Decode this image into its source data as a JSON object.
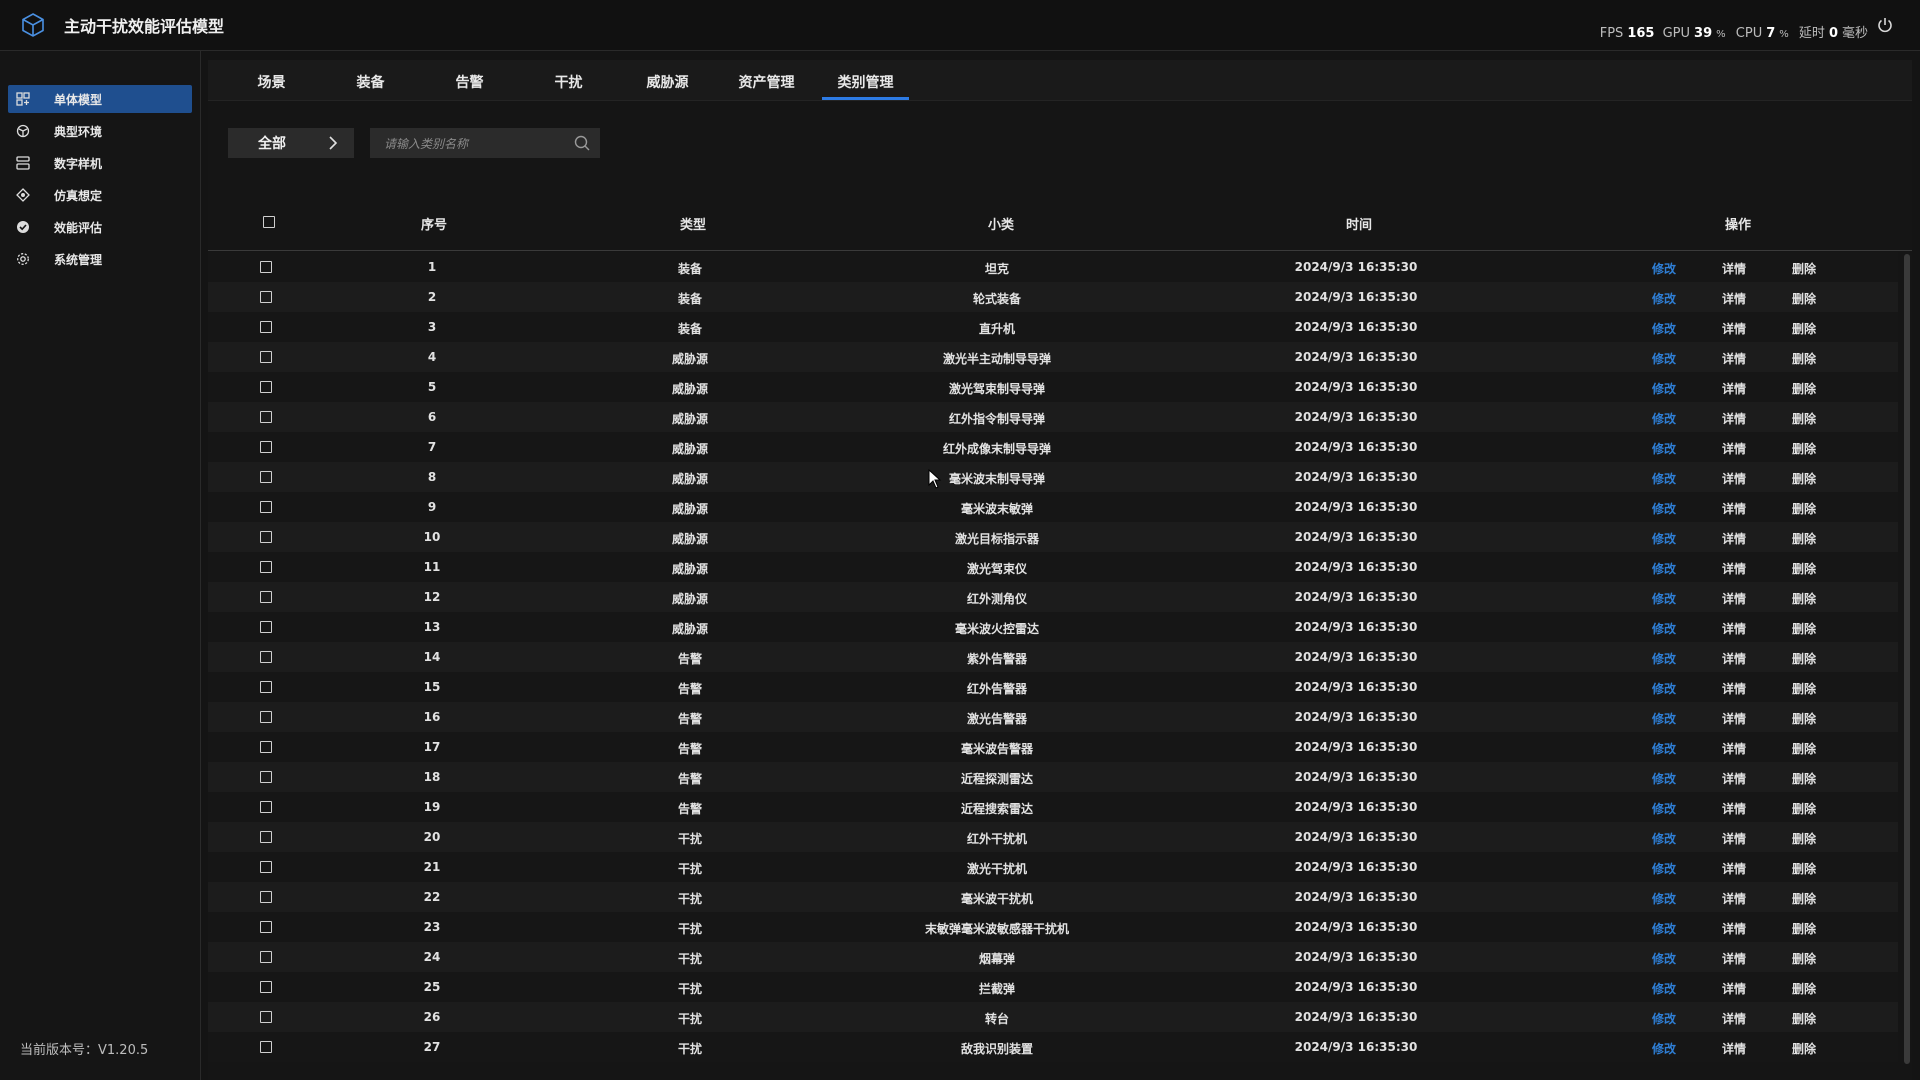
{
  "app": {
    "title": "主动干扰效能评估模型"
  },
  "perf": {
    "fps_label": "FPS",
    "fps": "165",
    "gpu_label": "GPU",
    "gpu": "39",
    "gpu_unit": "%",
    "cpu_label": "CPU",
    "cpu": "7",
    "cpu_unit": "%",
    "latency_label": "延时",
    "latency": "0",
    "latency_unit": "毫秒"
  },
  "sidebar": {
    "items": [
      {
        "label": "单体模型",
        "icon": "single-model-icon",
        "active": true
      },
      {
        "label": "典型环境",
        "icon": "environment-icon"
      },
      {
        "label": "数字样机",
        "icon": "prototype-icon"
      },
      {
        "label": "仿真想定",
        "icon": "simulation-icon"
      },
      {
        "label": "效能评估",
        "icon": "evaluation-icon"
      },
      {
        "label": "系统管理",
        "icon": "settings-icon"
      }
    ],
    "version": "当前版本号：V1.20.5"
  },
  "tabs": [
    {
      "label": "场景"
    },
    {
      "label": "装备"
    },
    {
      "label": "告警"
    },
    {
      "label": "干扰"
    },
    {
      "label": "威胁源"
    },
    {
      "label": "资产管理"
    },
    {
      "label": "类别管理",
      "active": true
    }
  ],
  "toolbar": {
    "filter_label": "全部",
    "search_placeholder": "请输入类别名称"
  },
  "table": {
    "columns": {
      "index": "序号",
      "type": "类型",
      "subtype": "小类",
      "time": "时间",
      "ops": "操作"
    },
    "ops": {
      "edit": "修改",
      "detail": "详情",
      "delete": "删除"
    },
    "rows": [
      {
        "index": "1",
        "type": "装备",
        "subtype": "坦克",
        "time": "2024/9/3 16:35:30"
      },
      {
        "index": "2",
        "type": "装备",
        "subtype": "轮式装备",
        "time": "2024/9/3 16:35:30"
      },
      {
        "index": "3",
        "type": "装备",
        "subtype": "直升机",
        "time": "2024/9/3 16:35:30"
      },
      {
        "index": "4",
        "type": "威胁源",
        "subtype": "激光半主动制导导弹",
        "time": "2024/9/3 16:35:30"
      },
      {
        "index": "5",
        "type": "威胁源",
        "subtype": "激光驾束制导导弹",
        "time": "2024/9/3 16:35:30"
      },
      {
        "index": "6",
        "type": "威胁源",
        "subtype": "红外指令制导导弹",
        "time": "2024/9/3 16:35:30"
      },
      {
        "index": "7",
        "type": "威胁源",
        "subtype": "红外成像末制导导弹",
        "time": "2024/9/3 16:35:30"
      },
      {
        "index": "8",
        "type": "威胁源",
        "subtype": "毫米波末制导导弹",
        "time": "2024/9/3 16:35:30"
      },
      {
        "index": "9",
        "type": "威胁源",
        "subtype": "毫米波末敏弹",
        "time": "2024/9/3 16:35:30"
      },
      {
        "index": "10",
        "type": "威胁源",
        "subtype": "激光目标指示器",
        "time": "2024/9/3 16:35:30"
      },
      {
        "index": "11",
        "type": "威胁源",
        "subtype": "激光驾束仪",
        "time": "2024/9/3 16:35:30"
      },
      {
        "index": "12",
        "type": "威胁源",
        "subtype": "红外测角仪",
        "time": "2024/9/3 16:35:30"
      },
      {
        "index": "13",
        "type": "威胁源",
        "subtype": "毫米波火控雷达",
        "time": "2024/9/3 16:35:30"
      },
      {
        "index": "14",
        "type": "告警",
        "subtype": "紫外告警器",
        "time": "2024/9/3 16:35:30"
      },
      {
        "index": "15",
        "type": "告警",
        "subtype": "红外告警器",
        "time": "2024/9/3 16:35:30"
      },
      {
        "index": "16",
        "type": "告警",
        "subtype": "激光告警器",
        "time": "2024/9/3 16:35:30"
      },
      {
        "index": "17",
        "type": "告警",
        "subtype": "毫米波告警器",
        "time": "2024/9/3 16:35:30"
      },
      {
        "index": "18",
        "type": "告警",
        "subtype": "近程探测雷达",
        "time": "2024/9/3 16:35:30"
      },
      {
        "index": "19",
        "type": "告警",
        "subtype": "近程搜索雷达",
        "time": "2024/9/3 16:35:30"
      },
      {
        "index": "20",
        "type": "干扰",
        "subtype": "红外干扰机",
        "time": "2024/9/3 16:35:30"
      },
      {
        "index": "21",
        "type": "干扰",
        "subtype": "激光干扰机",
        "time": "2024/9/3 16:35:30"
      },
      {
        "index": "22",
        "type": "干扰",
        "subtype": "毫米波干扰机",
        "time": "2024/9/3 16:35:30"
      },
      {
        "index": "23",
        "type": "干扰",
        "subtype": "末敏弹毫米波敏感器干扰机",
        "time": "2024/9/3 16:35:30"
      },
      {
        "index": "24",
        "type": "干扰",
        "subtype": "烟幕弹",
        "time": "2024/9/3 16:35:30"
      },
      {
        "index": "25",
        "type": "干扰",
        "subtype": "拦截弹",
        "time": "2024/9/3 16:35:30"
      },
      {
        "index": "26",
        "type": "干扰",
        "subtype": "转台",
        "time": "2024/9/3 16:35:30"
      },
      {
        "index": "27",
        "type": "干扰",
        "subtype": "敌我识别装置",
        "time": "2024/9/3 16:35:30"
      }
    ]
  },
  "colors": {
    "accent": "#2d7be5",
    "link": "#2f7fd6",
    "active_nav": "#1f4f8f"
  }
}
